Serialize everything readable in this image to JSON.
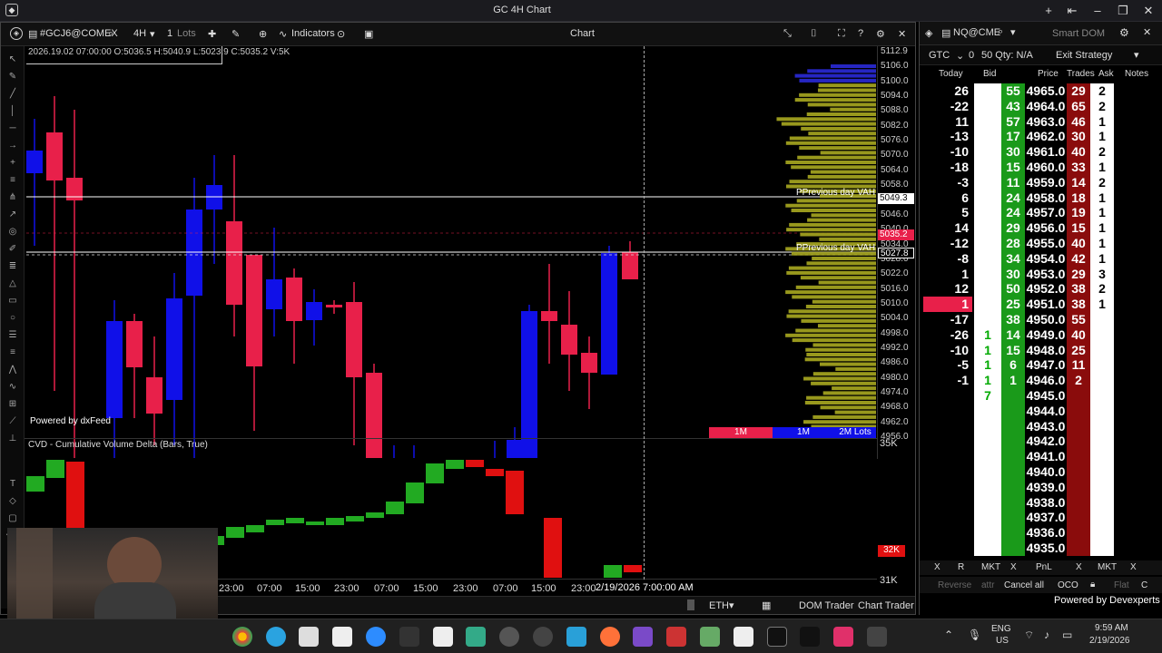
{
  "app": {
    "title": "GC 4H Chart"
  },
  "chart_toolbar": {
    "symbol": "#GCJ6@COMEX",
    "timeframe": "4H",
    "quantity": "1",
    "quantity_unit": "Lots",
    "indicators_label": "Indicators",
    "chart_label": "Chart"
  },
  "ohlc_info": "2026.19.02 07:00:00 O:5036.5 H:5040.9 L:5023.9 C:5035.2 V:5K",
  "powered_by": "Powered by dxFeed",
  "price_axis": {
    "ticks": [
      "5112.9",
      "5106.0",
      "5100.0",
      "5094.0",
      "5088.0",
      "5082.0",
      "5076.0",
      "5070.0",
      "5064.0",
      "5058.0",
      "5052.0",
      "5046.0",
      "5040.0",
      "5034.0",
      "5028.0",
      "5022.0",
      "5016.0",
      "5010.0",
      "5004.0",
      "4998.0",
      "4992.0",
      "4986.0",
      "4980.0",
      "4974.0",
      "4968.0",
      "4962.0",
      "4956.0"
    ],
    "current_price_tag": "5035.2",
    "prev_vah_tag": "5049.3",
    "crosshair_price": "5027.8"
  },
  "levels": {
    "vah_label_1": "PPrevious day VAH",
    "vah_label_2": "PPrevious day VAH"
  },
  "volume_profile_labels": [
    "1M",
    "1M",
    "2M Lots"
  ],
  "cvd": {
    "title": "CVD - Cumulative Volume Delta (Bars, True)",
    "axis_top": "35K",
    "axis_tag": "32K",
    "axis_bottom": "31K"
  },
  "time_axis": {
    "labels": [
      "23:00",
      "07:00",
      "15:00",
      "23:00",
      "07:00",
      "15:00",
      "23:00",
      "07:00",
      "15:00",
      "23:00"
    ],
    "crosshair_time": "2/19/2026 7:00:00 AM"
  },
  "chart_footer": {
    "session": "ETH",
    "dom_trader": "DOM Trader",
    "chart_trader": "Chart Trader"
  },
  "dom": {
    "symbol": "NQ@CME",
    "title": "Smart DOM",
    "tif": "GTC",
    "qty_value": "0",
    "qty_label": "50 Qty: N/A",
    "exit_strategy": "Exit Strategy",
    "headers": [
      "Today",
      "Bid",
      "Price",
      "Trades",
      "Ask",
      "Notes"
    ],
    "rows": [
      {
        "today": "26",
        "bid": "",
        "bidvol": "55",
        "price": "4965.0",
        "trades": "29",
        "ask": "2"
      },
      {
        "today": "-22",
        "bid": "",
        "bidvol": "43",
        "price": "4964.0",
        "trades": "65",
        "ask": "2"
      },
      {
        "today": "11",
        "bid": "",
        "bidvol": "57",
        "price": "4963.0",
        "trades": "46",
        "ask": "1"
      },
      {
        "today": "-13",
        "bid": "",
        "bidvol": "17",
        "price": "4962.0",
        "trades": "30",
        "ask": "1"
      },
      {
        "today": "-10",
        "bid": "",
        "bidvol": "30",
        "price": "4961.0",
        "trades": "40",
        "ask": "2"
      },
      {
        "today": "-18",
        "bid": "",
        "bidvol": "15",
        "price": "4960.0",
        "trades": "33",
        "ask": "1"
      },
      {
        "today": "-3",
        "bid": "",
        "bidvol": "11",
        "price": "4959.0",
        "trades": "14",
        "ask": "2"
      },
      {
        "today": "6",
        "bid": "",
        "bidvol": "24",
        "price": "4958.0",
        "trades": "18",
        "ask": "1"
      },
      {
        "today": "5",
        "bid": "",
        "bidvol": "24",
        "price": "4957.0",
        "trades": "19",
        "ask": "1"
      },
      {
        "today": "14",
        "bid": "",
        "bidvol": "29",
        "price": "4956.0",
        "trades": "15",
        "ask": "1"
      },
      {
        "today": "-12",
        "bid": "",
        "bidvol": "28",
        "price": "4955.0",
        "trades": "40",
        "ask": "1"
      },
      {
        "today": "-8",
        "bid": "",
        "bidvol": "34",
        "price": "4954.0",
        "trades": "42",
        "ask": "1"
      },
      {
        "today": "1",
        "bid": "",
        "bidvol": "30",
        "price": "4953.0",
        "trades": "29",
        "ask": "3"
      },
      {
        "today": "12",
        "bid": "",
        "bidvol": "50",
        "price": "4952.0",
        "trades": "38",
        "ask": "2"
      },
      {
        "today": "1",
        "bid": "",
        "bidvol": "25",
        "price": "4951.0",
        "trades": "38",
        "ask": "1"
      },
      {
        "today": "-17",
        "bid": "",
        "bidvol": "38",
        "price": "4950.0",
        "trades": "55",
        "ask": ""
      },
      {
        "today": "-26",
        "bid": "1",
        "bidvol": "14",
        "price": "4949.0",
        "trades": "40",
        "ask": ""
      },
      {
        "today": "-10",
        "bid": "1",
        "bidvol": "15",
        "price": "4948.0",
        "trades": "25",
        "ask": ""
      },
      {
        "today": "-5",
        "bid": "1",
        "bidvol": "6",
        "price": "4947.0",
        "trades": "11",
        "ask": ""
      },
      {
        "today": "-1",
        "bid": "1",
        "bidvol": "1",
        "price": "4946.0",
        "trades": "2",
        "ask": ""
      },
      {
        "today": "",
        "bid": "7",
        "bidvol": "",
        "price": "4945.0",
        "trades": "",
        "ask": ""
      },
      {
        "today": "",
        "bid": "",
        "bidvol": "",
        "price": "4944.0",
        "trades": "",
        "ask": ""
      },
      {
        "today": "",
        "bid": "",
        "bidvol": "",
        "price": "4943.0",
        "trades": "",
        "ask": ""
      },
      {
        "today": "",
        "bid": "",
        "bidvol": "",
        "price": "4942.0",
        "trades": "",
        "ask": ""
      },
      {
        "today": "",
        "bid": "",
        "bidvol": "",
        "price": "4941.0",
        "trades": "",
        "ask": ""
      },
      {
        "today": "",
        "bid": "",
        "bidvol": "",
        "price": "4940.0",
        "trades": "",
        "ask": ""
      },
      {
        "today": "",
        "bid": "",
        "bidvol": "",
        "price": "4939.0",
        "trades": "",
        "ask": ""
      },
      {
        "today": "",
        "bid": "",
        "bidvol": "",
        "price": "4938.0",
        "trades": "",
        "ask": ""
      },
      {
        "today": "",
        "bid": "",
        "bidvol": "",
        "price": "4937.0",
        "trades": "",
        "ask": ""
      },
      {
        "today": "",
        "bid": "",
        "bidvol": "",
        "price": "4936.0",
        "trades": "",
        "ask": ""
      },
      {
        "today": "",
        "bid": "",
        "bidvol": "",
        "price": "4935.0",
        "trades": "",
        "ask": ""
      }
    ],
    "bottom_buttons": [
      "X",
      "R",
      "MKT",
      "X",
      "PnL",
      "X",
      "MKT",
      "X"
    ],
    "actions": {
      "reverse": "Reverse",
      "attr": "attr",
      "cancel_all": "Cancel all",
      "oco": "OCO",
      "flat": "Flat",
      "c": "C"
    },
    "powered_by": "Powered by Devexperts"
  },
  "taskbar": {
    "lang": "ENG",
    "region": "US",
    "time": "9:59 AM",
    "date": "2/19/2026"
  },
  "colors": {
    "bull": "#1010e8",
    "bear": "#e8204a",
    "cvd_up": "#22aa22",
    "cvd_down": "#e01010",
    "profile": "#a8a820",
    "dom_green": "#1a9a1a",
    "dom_red": "#8a0c0c"
  }
}
